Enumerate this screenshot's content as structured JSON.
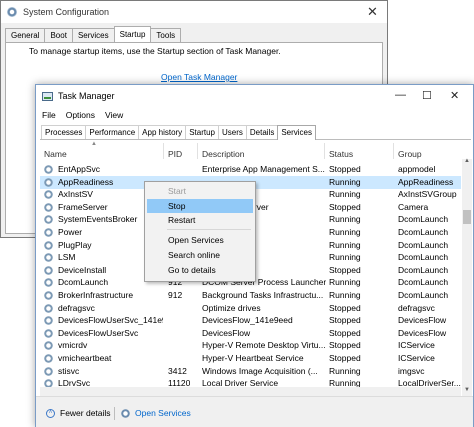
{
  "sysconfig": {
    "title": "System Configuration",
    "close": "✕",
    "tabs": [
      "General",
      "Boot",
      "Services",
      "Startup",
      "Tools"
    ],
    "active_tab": "Startup",
    "message": "To manage startup items, use the Startup section of Task Manager.",
    "link": "Open Task Manager"
  },
  "taskmanager": {
    "title": "Task Manager",
    "minimize": "—",
    "maximize": "☐",
    "close": "✕",
    "menu": [
      "File",
      "Options",
      "View"
    ],
    "tabs": [
      "Processes",
      "Performance",
      "App history",
      "Startup",
      "Users",
      "Details",
      "Services"
    ],
    "active_tab": "Services",
    "columns": [
      "Name",
      "PID",
      "Description",
      "Status",
      "Group"
    ],
    "rows": [
      {
        "name": "EntAppSvc",
        "pid": "",
        "desc": "Enterprise App Management S...",
        "status": "Stopped",
        "group": "appmodel"
      },
      {
        "name": "AppReadiness",
        "pid": "",
        "desc": "",
        "status": "Running",
        "group": "AppReadiness"
      },
      {
        "name": "AxInstSV",
        "pid": "",
        "desc": "ler (AxInstSV)",
        "status": "Running",
        "group": "AxInstSVGroup"
      },
      {
        "name": "FrameServer",
        "pid": "",
        "desc": "era Frame Server",
        "status": "Stopped",
        "group": "Camera"
      },
      {
        "name": "SystemEventsBroker",
        "pid": "",
        "desc": "",
        "status": "Running",
        "group": "DcomLaunch"
      },
      {
        "name": "Power",
        "pid": "",
        "desc": "",
        "status": "Running",
        "group": "DcomLaunch"
      },
      {
        "name": "PlugPlay",
        "pid": "",
        "desc": "",
        "status": "Running",
        "group": "DcomLaunch"
      },
      {
        "name": "LSM",
        "pid": "",
        "desc": "Manager",
        "status": "Running",
        "group": "DcomLaunch"
      },
      {
        "name": "DeviceInstall",
        "pid": "",
        "desc": "e",
        "status": "Stopped",
        "group": "DcomLaunch"
      },
      {
        "name": "DcomLaunch",
        "pid": "912",
        "desc": "DCOM Server Process Launcher",
        "status": "Running",
        "group": "DcomLaunch"
      },
      {
        "name": "BrokerInfrastructure",
        "pid": "912",
        "desc": "Background Tasks Infrastructu...",
        "status": "Running",
        "group": "DcomLaunch"
      },
      {
        "name": "defragsvc",
        "pid": "",
        "desc": "Optimize drives",
        "status": "Stopped",
        "group": "defragsvc"
      },
      {
        "name": "DevicesFlowUserSvc_141e9...",
        "pid": "",
        "desc": "DevicesFlow_141e9eed",
        "status": "Stopped",
        "group": "DevicesFlow"
      },
      {
        "name": "DevicesFlowUserSvc",
        "pid": "",
        "desc": "DevicesFlow",
        "status": "Stopped",
        "group": "DevicesFlow"
      },
      {
        "name": "vmicrdv",
        "pid": "",
        "desc": "Hyper-V Remote Desktop Virtu...",
        "status": "Stopped",
        "group": "ICService"
      },
      {
        "name": "vmicheartbeat",
        "pid": "",
        "desc": "Hyper-V Heartbeat Service",
        "status": "Stopped",
        "group": "ICService"
      },
      {
        "name": "stisvc",
        "pid": "3412",
        "desc": "Windows Image Acquisition (...",
        "status": "Running",
        "group": "imgsvc"
      },
      {
        "name": "LDrvSvc",
        "pid": "11120",
        "desc": "Local Driver Service",
        "status": "Running",
        "group": "LocalDriverSer..."
      }
    ],
    "selected_row": "AppReadiness",
    "footer": {
      "fewer": "Fewer details",
      "open_services": "Open Services"
    }
  },
  "context_menu": {
    "items": [
      "Start",
      "Stop",
      "Restart",
      "Open Services",
      "Search online",
      "Go to details"
    ],
    "highlighted": "Stop",
    "disabled": [
      "Start"
    ]
  }
}
